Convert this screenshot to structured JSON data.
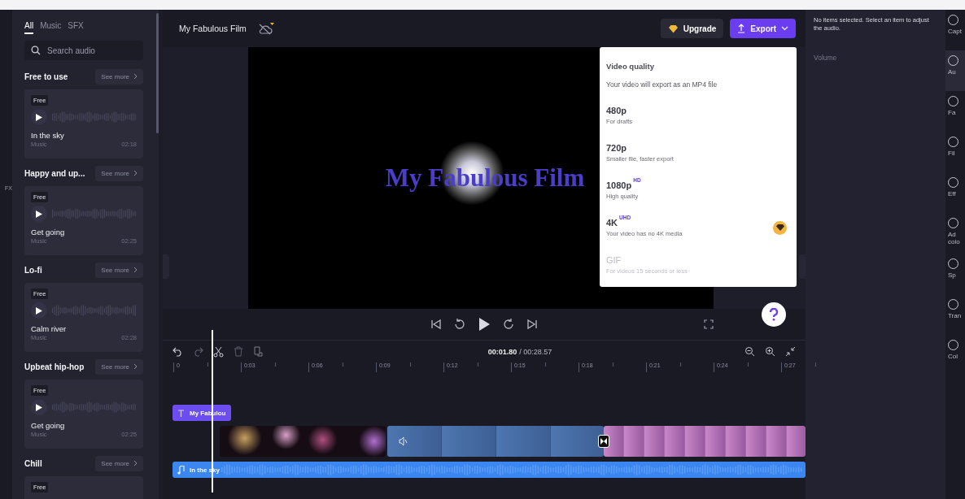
{
  "left_rail": {
    "labels": [
      "FX"
    ]
  },
  "audio_panel": {
    "tabs": [
      {
        "label": "All",
        "selected": true
      },
      {
        "label": "Music",
        "selected": false
      },
      {
        "label": "SFX",
        "selected": false
      }
    ],
    "search": {
      "placeholder": "Search audio"
    },
    "sections": [
      {
        "title": "Free to use",
        "see_more": "See more",
        "tracks": [
          {
            "badge": "Free",
            "title": "In the sky",
            "genre": "Music",
            "duration": "02:18"
          }
        ]
      },
      {
        "title": "Happy and up...",
        "see_more": "See more",
        "tracks": [
          {
            "badge": "Free",
            "title": "Get going",
            "genre": "Music",
            "duration": "02:25"
          }
        ]
      },
      {
        "title": "Lo-fi",
        "see_more": "See more",
        "tracks": [
          {
            "badge": "Free",
            "title": "Calm river",
            "genre": "Music",
            "duration": "02:28"
          }
        ]
      },
      {
        "title": "Upbeat hip-hop",
        "see_more": "See more",
        "tracks": [
          {
            "badge": "Free",
            "title": "Get going",
            "genre": "Music",
            "duration": "02:25"
          }
        ]
      },
      {
        "title": "Chill",
        "see_more": "See more",
        "tracks": [
          {
            "badge": "Free"
          }
        ]
      }
    ]
  },
  "header": {
    "project_title": "My Fabulous Film",
    "upgrade": "Upgrade",
    "export": "Export"
  },
  "preview": {
    "title_overlay": "My Fabulous Film"
  },
  "export_menu": {
    "heading": "Video quality",
    "note": "Your video will export as an MP4 file",
    "options": [
      {
        "label": "480p",
        "description": "For drafts",
        "disabled": false,
        "premium": false
      },
      {
        "label": "720p",
        "description": "Smaller file, faster export",
        "disabled": false,
        "premium": false
      },
      {
        "label": "1080p",
        "tag": "HD",
        "description": "High quality",
        "disabled": false,
        "premium": false
      },
      {
        "label": "4K",
        "tag": "UHD",
        "description": "Your video has no 4K media",
        "disabled": false,
        "premium": true
      },
      {
        "label": "GIF",
        "description": "For videos 15 seconds or less",
        "disabled": true,
        "premium": false
      }
    ]
  },
  "timeline": {
    "current_time": "00:01.80",
    "total_time": "/ 00:28.57",
    "ruler": [
      "0",
      "0:03",
      "0:06",
      "0:09",
      "0:12",
      "0:15",
      "0:18",
      "0:21",
      "0:24",
      "0:27"
    ],
    "text_clip": "My Fabulou",
    "audio_clip": "In the sky"
  },
  "properties": {
    "message": "No items selected. Select an item to adjust the audio.",
    "volume_label": "Volume"
  },
  "right_rail": {
    "items": [
      {
        "label": "Capt",
        "selected": false
      },
      {
        "label": "Au",
        "selected": true
      },
      {
        "label": "Fa",
        "selected": false
      },
      {
        "label": "Fil",
        "selected": false
      },
      {
        "label": "Eff",
        "selected": false
      },
      {
        "label": "Ad colo",
        "selected": false
      },
      {
        "label": "Sp",
        "selected": false
      },
      {
        "label": "Tran",
        "selected": false
      },
      {
        "label": "Col",
        "selected": false
      }
    ]
  }
}
